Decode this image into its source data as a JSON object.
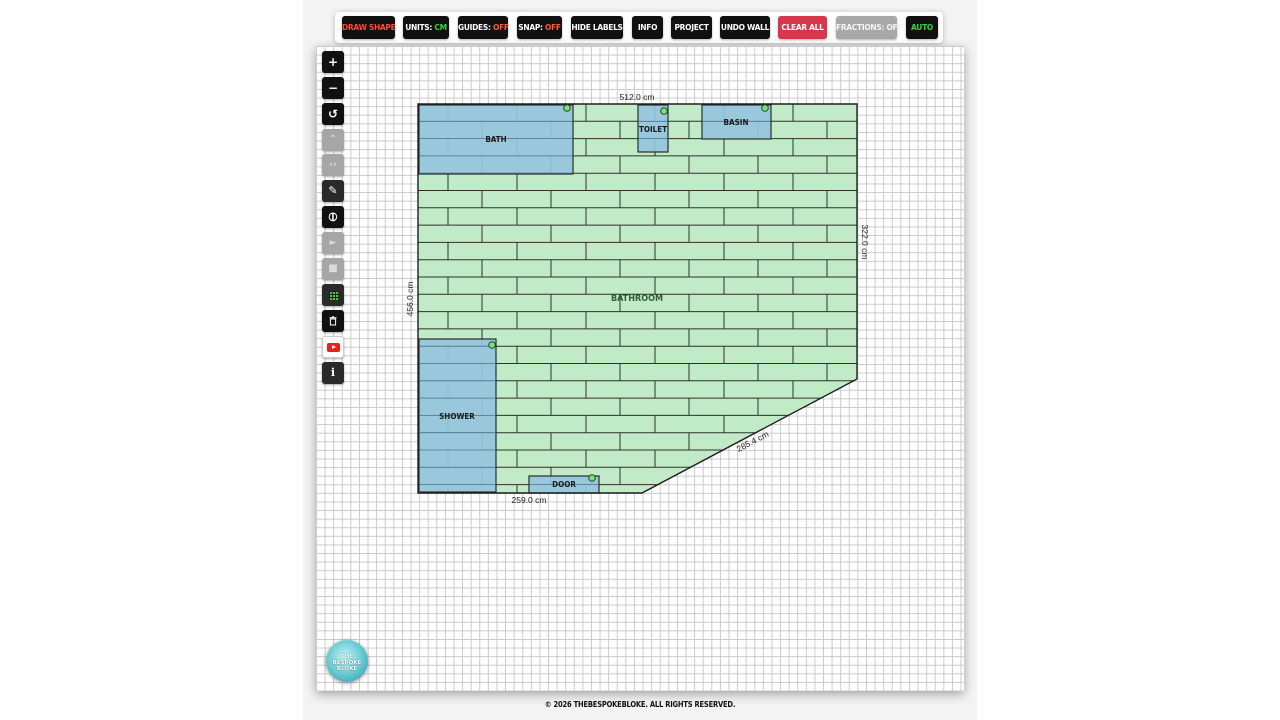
{
  "toolbar": {
    "draw_shape": "DRAW SHAPE",
    "units_label": "UNITS: ",
    "units_value": "CM",
    "guides_label": "GUIDES: ",
    "guides_value": "OFF",
    "snap_label": "SNAP: ",
    "snap_value": "OFF",
    "hide_labels": "HIDE LABELS",
    "info": "INFO",
    "project": "PROJECT",
    "undo_wall": "UNDO WALL",
    "clear_all": "CLEAR ALL",
    "fractions": "FRACTIONS: OFF",
    "auto": "AUTO"
  },
  "sidebar": {
    "zoom_in": "+",
    "zoom_out": "−",
    "reset": "↺",
    "up": "⌃",
    "code": "‹›",
    "measure": "✎",
    "compass": "⦶",
    "play": "►",
    "stop": "■",
    "info": "i"
  },
  "plan": {
    "room_label": "BATHROOM",
    "fixtures": {
      "bath": "BATH",
      "toilet": "TOILET",
      "basin": "BASIN",
      "shower": "SHOWER",
      "door": "DOOR"
    },
    "dimensions": {
      "top": "512.0 cm",
      "right": "322.0 cm",
      "left": "456.0 cm",
      "bottom": "259.0 cm",
      "diagonal": "285.4 cm"
    },
    "colors": {
      "floor": "#c1ebc6",
      "fixture": "#96c4de",
      "tile_line": "#2f2f2f"
    }
  },
  "logo_text": "THE BESPOKE BLOKE",
  "footer": "© 2026 THEBESPOKEBLOKE. ALL RIGHTS RESERVED."
}
